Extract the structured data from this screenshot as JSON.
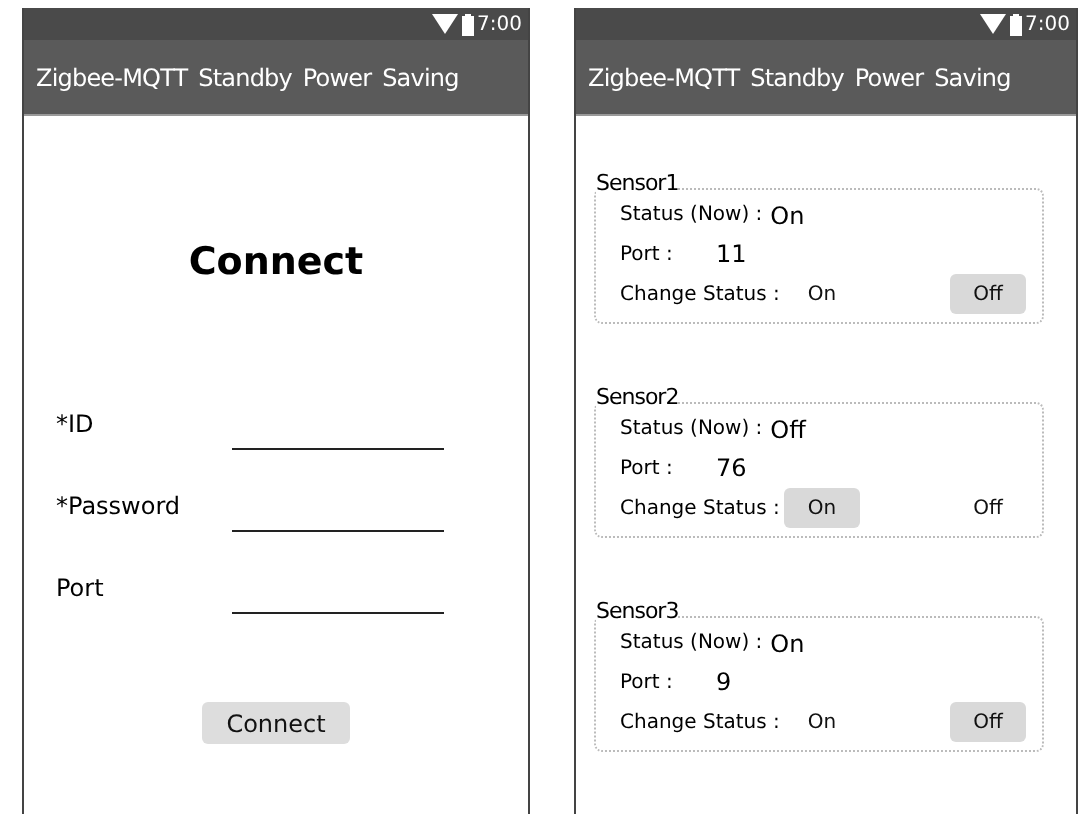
{
  "screens": [
    {
      "kind": "login",
      "status_bar": {
        "time": "7:00"
      },
      "app_bar": {
        "title": "Zigbee-MQTT Standby Power Saving"
      },
      "heading": "Connect",
      "fields": [
        {
          "label": "*ID"
        },
        {
          "label": "*Password"
        },
        {
          "label": "Port"
        }
      ],
      "button": "Connect"
    },
    {
      "kind": "sensors",
      "status_bar": {
        "time": "7:00"
      },
      "app_bar": {
        "title": "Zigbee-MQTT Standby Power Saving"
      },
      "sensors": [
        {
          "name": "Sensor1",
          "status_label": "Status (Now) :",
          "status": "On",
          "port_label": "Port :",
          "port": "11",
          "change_label": "Change Status :",
          "options": [
            {
              "label": "On",
              "selected": false
            },
            {
              "label": "Off",
              "selected": true
            }
          ]
        },
        {
          "name": "Sensor2",
          "status_label": "Status (Now) :",
          "status": "Off",
          "port_label": "Port :",
          "port": "76",
          "change_label": "Change Status :",
          "options": [
            {
              "label": "On",
              "selected": true
            },
            {
              "label": "Off",
              "selected": false
            }
          ]
        },
        {
          "name": "Sensor3",
          "status_label": "Status (Now) :",
          "status": "On",
          "port_label": "Port :",
          "port": "9",
          "change_label": "Change Status :",
          "options": [
            {
              "label": "On",
              "selected": false
            },
            {
              "label": "Off",
              "selected": true
            }
          ]
        }
      ]
    }
  ]
}
